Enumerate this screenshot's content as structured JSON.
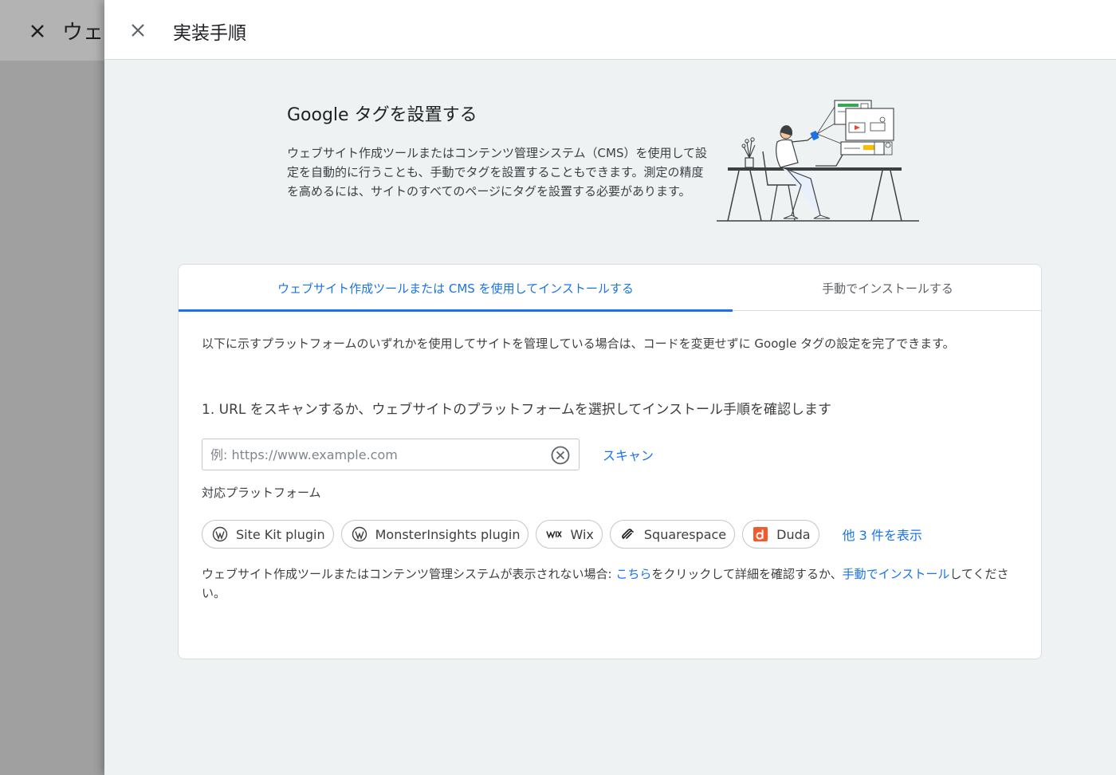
{
  "background": {
    "title": "ウェ",
    "close_icon": "close-icon"
  },
  "drawer": {
    "title": "実装手順",
    "close_icon": "close-icon"
  },
  "intro": {
    "heading": "Google タグを設置する",
    "body": "ウェブサイト作成ツールまたはコンテンツ管理システム（CMS）を使用して設定を自動的に行うことも、手動でタグを設置することもできます。測定の精度を高めるには、サイトのすべてのページにタグを設置する必要があります。"
  },
  "tabs": [
    {
      "label": "ウェブサイト作成ツールまたは CMS を使用してインストールする",
      "active": true
    },
    {
      "label": "手動でインストールする",
      "active": false
    }
  ],
  "content": {
    "description": "以下に示すプラットフォームのいずれかを使用してサイトを管理している場合は、コードを変更せずに Google タグの設定を完了できます。",
    "step_label": "1. URL をスキャンするか、ウェブサイトのプラットフォームを選択してインストール手順を確認します",
    "url_input": {
      "value": "",
      "placeholder": "例: https://www.example.com"
    },
    "scan_label": "スキャン",
    "platforms_label": "対応プラットフォーム",
    "platforms": [
      {
        "label": "Site Kit plugin",
        "icon": "wordpress-icon"
      },
      {
        "label": "MonsterInsights plugin",
        "icon": "wordpress-icon"
      },
      {
        "label": "Wix",
        "icon": "wix-icon"
      },
      {
        "label": "Squarespace",
        "icon": "squarespace-icon"
      },
      {
        "label": "Duda",
        "icon": "duda-icon"
      }
    ],
    "show_more_label": "他 3 件を表示",
    "footer": {
      "text_before": "ウェブサイト作成ツールまたはコンテンツ管理システムが表示されない場合: ",
      "link_here": "こちら",
      "text_middle": "をクリックして詳細を確認するか、",
      "link_manual": "手動でインストール",
      "text_after": "してください。"
    }
  },
  "colors": {
    "accent": "#1a73e8",
    "duda": "#f15a2b"
  }
}
